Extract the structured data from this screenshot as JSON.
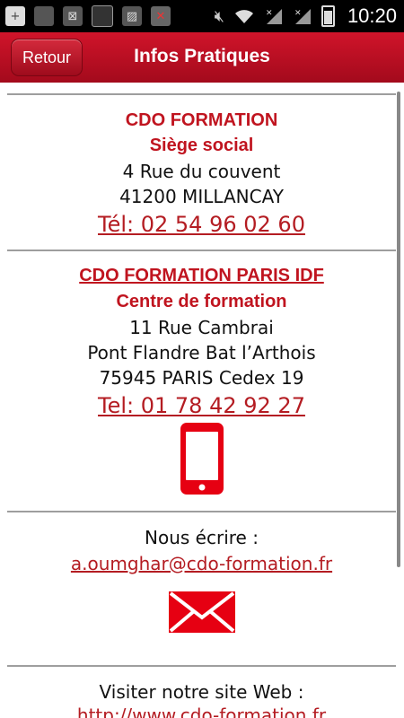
{
  "status_bar": {
    "time": "10:20",
    "left_icons": [
      "add-icon",
      "notification-icon",
      "notification-icon",
      "notification-icon",
      "image-icon",
      "no-sim-icon"
    ],
    "right_icons": [
      "mute-icon",
      "wifi-icon",
      "signal-icon",
      "signal-icon",
      "battery-icon"
    ]
  },
  "header": {
    "back_label": "Retour",
    "title": "Infos Pratiques"
  },
  "siege": {
    "company": "CDO FORMATION",
    "subtitle": "Siège social",
    "address_line1": "4 Rue du couvent",
    "address_line2": "41200 MILLANCAY",
    "phone": "Tél: 02 54 96 02 60"
  },
  "paris": {
    "company": "CDO FORMATION PARIS IDF",
    "subtitle": "Centre de formation",
    "address_line1": "11 Rue Cambrai",
    "address_line2": "Pont Flandre Bat l’Arthois",
    "address_line3": "75945   PARIS Cedex 19",
    "phone": "Tel: 01 78 42 92 27 "
  },
  "contact": {
    "label": "Nous écrire :",
    "email": "a.oumghar@cdo-formation.fr "
  },
  "website": {
    "label": "Visiter notre site Web :",
    "url": "http://www.cdo-formation.fr"
  },
  "colors": {
    "accent": "#c0141f",
    "icon_red": "#e60012",
    "header_top": "#d0142a",
    "header_bottom": "#a30a1c"
  }
}
